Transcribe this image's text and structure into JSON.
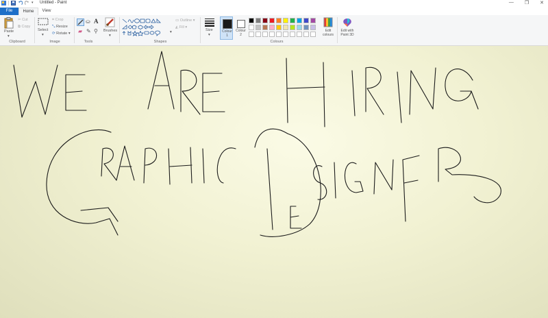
{
  "window": {
    "title": "Untitled - Paint"
  },
  "tabs": [
    {
      "label": "File"
    },
    {
      "label": "Home"
    },
    {
      "label": "View"
    }
  ],
  "clipboard": {
    "paste": "Paste",
    "cut": "Cut",
    "copy": "Copy",
    "group": "Clipboard"
  },
  "image": {
    "select": "Select",
    "crop": "Crop",
    "resize": "Resize",
    "rotate": "Rotate",
    "group": "Image"
  },
  "tools": {
    "group": "Tools",
    "text_tool": "A"
  },
  "brushes": {
    "label": "Brushes"
  },
  "shapes": {
    "outline": "Outline",
    "fill": "Fill",
    "group": "Shapes"
  },
  "size": {
    "label": "Size"
  },
  "colour1": {
    "label": "Colour 1",
    "color": "#1a1a1a"
  },
  "colour2": {
    "label": "Colour 2",
    "color": "#ffffff"
  },
  "colours": {
    "group": "Colours",
    "row1": [
      "#000000",
      "#7f7f7f",
      "#880015",
      "#ed1c24",
      "#ff7f27",
      "#fff200",
      "#22b14c",
      "#00a2e8",
      "#3f48cc",
      "#a349a4"
    ],
    "row2": [
      "#ffffff",
      "#c3c3c3",
      "#b97a57",
      "#ffaec9",
      "#ffc90e",
      "#efe4b0",
      "#b5e61d",
      "#99d9ea",
      "#7092be",
      "#c8bfe7"
    ],
    "row3": [
      "#ffffff",
      "#ffffff",
      "#ffffff",
      "#ffffff",
      "#ffffff",
      "#ffffff",
      "#ffffff",
      "#ffffff",
      "#ffffff",
      "#ffffff"
    ]
  },
  "edit_colours": {
    "label": "Edit colours"
  },
  "paint3d": {
    "label": "Edit with Paint 3D"
  }
}
